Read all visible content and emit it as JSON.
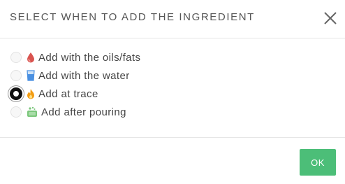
{
  "dialog": {
    "title": "SELECT WHEN TO ADD THE INGREDIENT",
    "close_icon": "close-icon",
    "options": [
      {
        "label": "Add with the oils/fats",
        "icon": "oil-drop-icon",
        "icon_color": "#d9534f",
        "checked": false
      },
      {
        "label": "Add with the water",
        "icon": "water-glass-icon",
        "icon_color": "#4a90e2",
        "checked": false
      },
      {
        "label": "Add at trace",
        "icon": "flame-icon",
        "icon_color": "#f39c12",
        "checked": true
      },
      {
        "label": "Add after pouring",
        "icon": "soap-mold-icon",
        "icon_color": "#5cb85c",
        "checked": false
      }
    ],
    "ok_label": "OK",
    "accent_color": "#4cbe78"
  }
}
